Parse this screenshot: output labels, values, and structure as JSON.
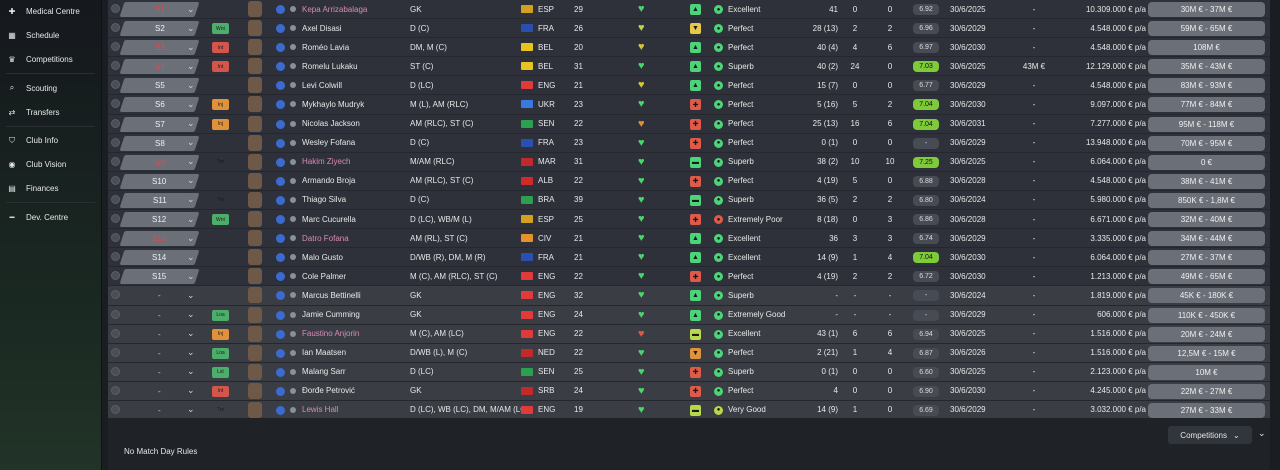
{
  "sidebar": {
    "items": [
      {
        "label": "Medical Centre",
        "icon": "medical-icon"
      },
      {
        "label": "Schedule",
        "icon": "calendar-icon"
      },
      {
        "label": "Competitions",
        "icon": "trophy-icon"
      },
      {
        "label": "Scouting",
        "icon": "search-icon"
      },
      {
        "label": "Transfers",
        "icon": "transfer-icon"
      },
      {
        "label": "Club Info",
        "icon": "shield-icon"
      },
      {
        "label": "Club Vision",
        "icon": "vision-icon"
      },
      {
        "label": "Finances",
        "icon": "money-icon"
      },
      {
        "label": "Dev. Centre",
        "icon": "dev-icon"
      }
    ]
  },
  "footer": {
    "match_day_rules": "No Match Day Rules",
    "competitions_label": "Competitions"
  },
  "rows": [
    {
      "sel": "S1",
      "sel_red": true,
      "tag": "",
      "name": "Kepa Arrizabalaga",
      "pink": true,
      "pos": "GK",
      "ctry": "ESP",
      "age": "29",
      "heart": "#4ad66d",
      "status_col": "#4cd47a",
      "status": "▲",
      "pot_col": "#4cd47a",
      "pot": "Excellent",
      "apps": "41",
      "gls": "0",
      "ast": "0",
      "rat": "6.92",
      "rat_hi": false,
      "exp": "30/6/2025",
      "rc": "-",
      "wage": "10.309.000 € p/a",
      "val": "30M € - 37M €",
      "flag": "#d4a020"
    },
    {
      "sel": "S2",
      "sel_red": false,
      "tag": "Wnt",
      "name": "Axel Disasi",
      "pink": false,
      "pos": "D (C)",
      "ctry": "FRA",
      "age": "26",
      "heart": "#b7d84a",
      "status_col": "#e8c84a",
      "status": "▼",
      "pot_col": "#4cd47a",
      "pot": "Perfect",
      "apps": "28 (13)",
      "gls": "2",
      "ast": "2",
      "rat": "6.96",
      "rat_hi": false,
      "exp": "30/6/2029",
      "rc": "-",
      "wage": "4.548.000 € p/a",
      "val": "59M € - 65M €",
      "flag": "#2a4fb0"
    },
    {
      "sel": "S3",
      "sel_red": true,
      "tag": "Int",
      "name": "Roméo Lavia",
      "pink": false,
      "pos": "DM, M (C)",
      "ctry": "BEL",
      "age": "20",
      "heart": "#d8c43a",
      "status_col": "#4cd47a",
      "status": "▲",
      "pot_col": "#4cd47a",
      "pot": "Perfect",
      "apps": "40 (4)",
      "gls": "4",
      "ast": "6",
      "rat": "6.97",
      "rat_hi": false,
      "exp": "30/6/2030",
      "rc": "-",
      "wage": "4.548.000 € p/a",
      "val": "108M €",
      "flag": "#e8c420"
    },
    {
      "sel": "S4",
      "sel_red": true,
      "tag": "Int",
      "name": "Romelu Lukaku",
      "pink": false,
      "pos": "ST (C)",
      "ctry": "BEL",
      "age": "31",
      "heart": "#4ad66d",
      "status_col": "#4cd47a",
      "status": "▲",
      "pot_col": "#4cd47a",
      "pot": "Superb",
      "apps": "40 (2)",
      "gls": "24",
      "ast": "0",
      "rat": "7.03",
      "rat_hi": true,
      "exp": "30/6/2025",
      "rc": "43M €",
      "wage": "12.129.000 € p/a",
      "val": "35M € - 43M €",
      "flag": "#e8c420"
    },
    {
      "sel": "S5",
      "sel_red": false,
      "tag": "",
      "name": "Levi Colwill",
      "pink": false,
      "pos": "D (LC)",
      "ctry": "ENG",
      "age": "21",
      "heart": "#d8c43a",
      "status_col": "#4cd47a",
      "status": "▲",
      "pot_col": "#4cd47a",
      "pot": "Perfect",
      "apps": "15 (7)",
      "gls": "0",
      "ast": "0",
      "rat": "6.77",
      "rat_hi": false,
      "exp": "30/6/2029",
      "rc": "-",
      "wage": "4.548.000 € p/a",
      "val": "83M € - 93M €",
      "flag": "#e03a3a"
    },
    {
      "sel": "S6",
      "sel_red": false,
      "tag": "Inj",
      "name": "Mykhaylo Mudryk",
      "pink": false,
      "pos": "M (L), AM (RLC)",
      "ctry": "UKR",
      "age": "23",
      "heart": "#4ad66d",
      "status_col": "#e05a4a",
      "status": "✚",
      "pot_col": "#4cd47a",
      "pot": "Perfect",
      "apps": "5 (16)",
      "gls": "5",
      "ast": "2",
      "rat": "7.04",
      "rat_hi": true,
      "exp": "30/6/2030",
      "rc": "-",
      "wage": "9.097.000 € p/a",
      "val": "77M € - 84M €",
      "flag": "#3a7ae0"
    },
    {
      "sel": "S7",
      "sel_red": false,
      "tag": "Inj",
      "name": "Nicolas Jackson",
      "pink": false,
      "pos": "AM (RLC), ST (C)",
      "ctry": "SEN",
      "age": "22",
      "heart": "#e0923a",
      "status_col": "#e05a4a",
      "status": "✚",
      "pot_col": "#4cd47a",
      "pot": "Perfect",
      "apps": "25 (13)",
      "gls": "16",
      "ast": "6",
      "rat": "7.04",
      "rat_hi": true,
      "exp": "30/6/2031",
      "rc": "-",
      "wage": "7.277.000 € p/a",
      "val": "95M € - 118M €",
      "flag": "#2aa050"
    },
    {
      "sel": "S8",
      "sel_red": false,
      "tag": "",
      "name": "Wesley Fofana",
      "pink": false,
      "pos": "D (C)",
      "ctry": "FRA",
      "age": "23",
      "heart": "#4ad66d",
      "status_col": "#e05a4a",
      "status": "✚",
      "pot_col": "#4cd47a",
      "pot": "Perfect",
      "apps": "0 (1)",
      "gls": "0",
      "ast": "0",
      "rat": "-",
      "rat_hi": false,
      "exp": "30/6/2029",
      "rc": "-",
      "wage": "13.948.000 € p/a",
      "val": "70M € - 95M €",
      "flag": "#2a4fb0"
    },
    {
      "sel": "S9",
      "sel_red": true,
      "tag": "Trn",
      "name": "Hakim Ziyech",
      "pink": true,
      "pos": "M/AM (RLC)",
      "ctry": "MAR",
      "age": "31",
      "heart": "#4ad66d",
      "status_col": "#4cd47a",
      "status": "▬",
      "pot_col": "#4cd47a",
      "pot": "Superb",
      "apps": "38 (2)",
      "gls": "10",
      "ast": "10",
      "rat": "7.25",
      "rat_hi": true,
      "exp": "30/6/2025",
      "rc": "-",
      "wage": "6.064.000 € p/a",
      "val": "0 €",
      "flag": "#c02a2a"
    },
    {
      "sel": "S10",
      "sel_red": false,
      "tag": "",
      "name": "Armando Broja",
      "pink": false,
      "pos": "AM (RLC), ST (C)",
      "ctry": "ALB",
      "age": "22",
      "heart": "#4ad66d",
      "status_col": "#e05a4a",
      "status": "✚",
      "pot_col": "#4cd47a",
      "pot": "Perfect",
      "apps": "4 (19)",
      "gls": "5",
      "ast": "0",
      "rat": "6.88",
      "rat_hi": false,
      "exp": "30/6/2028",
      "rc": "-",
      "wage": "4.548.000 € p/a",
      "val": "38M € - 41M €",
      "flag": "#d02a2a"
    },
    {
      "sel": "S11",
      "sel_red": false,
      "tag": "Trn",
      "name": "Thiago Silva",
      "pink": false,
      "pos": "D (C)",
      "ctry": "BRA",
      "age": "39",
      "heart": "#4ad66d",
      "status_col": "#4cd47a",
      "status": "▬",
      "pot_col": "#4cd47a",
      "pot": "Superb",
      "apps": "36 (5)",
      "gls": "2",
      "ast": "2",
      "rat": "6.80",
      "rat_hi": false,
      "exp": "30/6/2024",
      "rc": "-",
      "wage": "5.980.000 € p/a",
      "val": "850K € - 1,8M €",
      "flag": "#2aa050"
    },
    {
      "sel": "S12",
      "sel_red": false,
      "tag": "Wnt",
      "name": "Marc Cucurella",
      "pink": false,
      "pos": "D (LC), WB/M (L)",
      "ctry": "ESP",
      "age": "25",
      "heart": "#4ad66d",
      "status_col": "#e05a4a",
      "status": "✚",
      "pot_col": "#e05a4a",
      "pot": "Extremely Poor",
      "apps": "8 (18)",
      "gls": "0",
      "ast": "3",
      "rat": "6.86",
      "rat_hi": false,
      "exp": "30/6/2028",
      "rc": "-",
      "wage": "6.671.000 € p/a",
      "val": "32M € - 40M €",
      "flag": "#d4a020"
    },
    {
      "sel": "S13",
      "sel_red": true,
      "tag": "",
      "name": "Datro Fofana",
      "pink": true,
      "pos": "AM (RL), ST (C)",
      "ctry": "CIV",
      "age": "21",
      "heart": "#4ad66d",
      "status_col": "#4cd47a",
      "status": "▲",
      "pot_col": "#4cd47a",
      "pot": "Excellent",
      "apps": "36",
      "gls": "3",
      "ast": "3",
      "rat": "6.74",
      "rat_hi": false,
      "exp": "30/6/2029",
      "rc": "-",
      "wage": "3.335.000 € p/a",
      "val": "34M € - 44M €",
      "flag": "#e8902a"
    },
    {
      "sel": "S14",
      "sel_red": false,
      "tag": "",
      "name": "Malo Gusto",
      "pink": false,
      "pos": "D/WB (R), DM, M (R)",
      "ctry": "FRA",
      "age": "21",
      "heart": "#4ad66d",
      "status_col": "#4cd47a",
      "status": "▲",
      "pot_col": "#4cd47a",
      "pot": "Excellent",
      "apps": "14 (9)",
      "gls": "1",
      "ast": "4",
      "rat": "7.04",
      "rat_hi": true,
      "exp": "30/6/2030",
      "rc": "-",
      "wage": "6.064.000 € p/a",
      "val": "27M € - 37M €",
      "flag": "#2a4fb0"
    },
    {
      "sel": "S15",
      "sel_red": false,
      "tag": "",
      "name": "Cole Palmer",
      "pink": false,
      "pos": "M (C), AM (RLC), ST (C)",
      "ctry": "ENG",
      "age": "22",
      "heart": "#4ad66d",
      "status_col": "#e05a4a",
      "status": "✚",
      "pot_col": "#4cd47a",
      "pot": "Perfect",
      "apps": "4 (19)",
      "gls": "2",
      "ast": "2",
      "rat": "6.72",
      "rat_hi": false,
      "exp": "30/6/2030",
      "rc": "-",
      "wage": "1.213.000 € p/a",
      "val": "49M € - 65M €",
      "flag": "#e03a3a"
    },
    {
      "sel": "-",
      "sel_red": false,
      "tag": "",
      "name": "Marcus Bettinelli",
      "pink": false,
      "pos": "GK",
      "ctry": "ENG",
      "age": "32",
      "heart": "#4ad66d",
      "status_col": "#4cd47a",
      "status": "▲",
      "pot_col": "#4cd47a",
      "pot": "Superb",
      "apps": "-",
      "gls": "-",
      "ast": "-",
      "rat": "-",
      "rat_hi": false,
      "exp": "30/6/2024",
      "rc": "-",
      "wage": "1.819.000 € p/a",
      "val": "45K € - 180K €",
      "flag": "#e03a3a",
      "loan": true
    },
    {
      "sel": "-",
      "sel_red": false,
      "tag": "Loa",
      "name": "Jamie Cumming",
      "pink": false,
      "pos": "GK",
      "ctry": "ENG",
      "age": "24",
      "heart": "#4ad66d",
      "status_col": "#4cd47a",
      "status": "▲",
      "pot_col": "#4cd47a",
      "pot": "Extremely Good",
      "apps": "-",
      "gls": "-",
      "ast": "-",
      "rat": "-",
      "rat_hi": false,
      "exp": "30/6/2029",
      "rc": "-",
      "wage": "606.000 € p/a",
      "val": "110K € - 450K €",
      "flag": "#e03a3a",
      "loan": true
    },
    {
      "sel": "-",
      "sel_red": false,
      "tag": "Inj",
      "name": "Faustino Anjorin",
      "pink": true,
      "pos": "M (C), AM (LC)",
      "ctry": "ENG",
      "age": "22",
      "heart": "#e05a4a",
      "status_col": "#b7d84a",
      "status": "▬",
      "pot_col": "#4cd47a",
      "pot": "Excellent",
      "apps": "43 (1)",
      "gls": "6",
      "ast": "6",
      "rat": "6.94",
      "rat_hi": false,
      "exp": "30/6/2025",
      "rc": "-",
      "wage": "1.516.000 € p/a",
      "val": "20M € - 24M €",
      "flag": "#e03a3a",
      "loan": true
    },
    {
      "sel": "-",
      "sel_red": false,
      "tag": "Loa",
      "name": "Ian Maatsen",
      "pink": false,
      "pos": "D/WB (L), M (C)",
      "ctry": "NED",
      "age": "22",
      "heart": "#4ad66d",
      "status_col": "#e0923a",
      "status": "▼",
      "pot_col": "#4cd47a",
      "pot": "Perfect",
      "apps": "2 (21)",
      "gls": "1",
      "ast": "4",
      "rat": "6.87",
      "rat_hi": false,
      "exp": "30/6/2026",
      "rc": "-",
      "wage": "1.516.000 € p/a",
      "val": "12,5M € - 15M €",
      "flag": "#c02a2a",
      "loan": true
    },
    {
      "sel": "-",
      "sel_red": false,
      "tag": "Lst",
      "name": "Malang Sarr",
      "pink": false,
      "pos": "D (LC)",
      "ctry": "SEN",
      "age": "25",
      "heart": "#4ad66d",
      "status_col": "#e05a4a",
      "status": "✚",
      "pot_col": "#4cd47a",
      "pot": "Superb",
      "apps": "0 (1)",
      "gls": "0",
      "ast": "0",
      "rat": "6.60",
      "rat_hi": false,
      "exp": "30/6/2025",
      "rc": "-",
      "wage": "2.123.000 € p/a",
      "val": "10M €",
      "flag": "#2aa050",
      "loan": true
    },
    {
      "sel": "-",
      "sel_red": false,
      "tag": "Int",
      "name": "Đorđe Petrović",
      "pink": false,
      "pos": "GK",
      "ctry": "SRB",
      "age": "24",
      "heart": "#4ad66d",
      "status_col": "#e05a4a",
      "status": "✚",
      "pot_col": "#4cd47a",
      "pot": "Perfect",
      "apps": "4",
      "gls": "0",
      "ast": "0",
      "rat": "6.90",
      "rat_hi": false,
      "exp": "30/6/2030",
      "rc": "-",
      "wage": "4.245.000 € p/a",
      "val": "22M € - 27M €",
      "flag": "#c02a2a",
      "loan": true
    },
    {
      "sel": "-",
      "sel_red": true,
      "tag": "Trn",
      "name": "Lewis Hall",
      "pink": true,
      "pos": "D (LC), WB (LC), DM, M/AM (LC)",
      "ctry": "ENG",
      "age": "19",
      "heart": "#4ad66d",
      "status_col": "#b7d84a",
      "status": "▬",
      "pot_col": "#b7d84a",
      "pot": "Very Good",
      "apps": "14 (9)",
      "gls": "1",
      "ast": "0",
      "rat": "6.69",
      "rat_hi": false,
      "exp": "30/6/2029",
      "rc": "-",
      "wage": "3.032.000 € p/a",
      "val": "27M € - 33M €",
      "flag": "#e03a3a",
      "loan": true
    }
  ]
}
